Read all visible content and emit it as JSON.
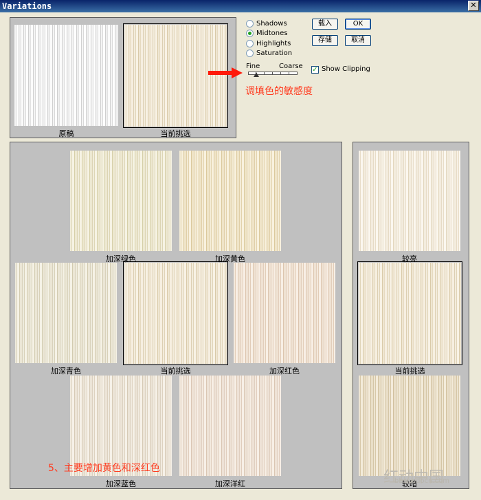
{
  "window": {
    "title": "Variations",
    "close_glyph": "✕"
  },
  "top": {
    "original_caption": "原稿",
    "current_pick_caption": "当前挑选"
  },
  "options": {
    "radios": [
      {
        "label": "Shadows",
        "selected": false
      },
      {
        "label": "Midtones",
        "selected": true
      },
      {
        "label": "Highlights",
        "selected": false
      },
      {
        "label": "Saturation",
        "selected": false
      }
    ],
    "slider": {
      "fine_label": "Fine",
      "coarse_label": "Coarse"
    },
    "show_clipping_label": "Show Clipping",
    "show_clipping_checked": true
  },
  "buttons": {
    "load": "载入",
    "ok": "OK",
    "save": "存储",
    "cancel": "取消"
  },
  "annotations": {
    "sensitivity": "调填色的敏感度",
    "step5": "5、主要增加黄色和深红色"
  },
  "color_grid": {
    "more_green": "加深绿色",
    "more_yellow": "加深黄色",
    "more_cyan": "加深青色",
    "current_pick": "当前挑选",
    "more_red": "加深红色",
    "more_blue": "加深蓝色",
    "more_magenta": "加深洋红"
  },
  "brightness": {
    "lighter": "较亮",
    "current_pick": "当前挑选",
    "darker": "较暗"
  },
  "watermark": {
    "url": "bbs.redocn.com"
  }
}
